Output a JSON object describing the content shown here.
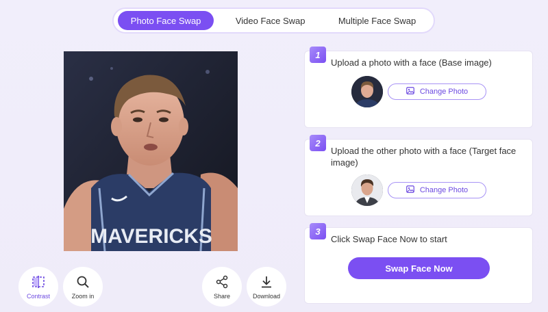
{
  "tabs": [
    {
      "label": "Photo Face Swap",
      "active": true
    },
    {
      "label": "Video Face Swap",
      "active": false
    },
    {
      "label": "Multiple Face Swap",
      "active": false
    }
  ],
  "preview": {
    "jersey_text": "MAVERICKS"
  },
  "tools": {
    "contrast": {
      "label": "Contrast",
      "icon": "compare-icon"
    },
    "zoom": {
      "label": "Zoom in",
      "icon": "zoom-icon"
    },
    "share": {
      "label": "Share",
      "icon": "share-icon"
    },
    "download": {
      "label": "Download",
      "icon": "download-icon"
    }
  },
  "steps": [
    {
      "number": "1",
      "title": "Upload a photo with a face (Base image)",
      "button": "Change Photo"
    },
    {
      "number": "2",
      "title": "Upload the other photo with a face (Target face image)",
      "button": "Change Photo"
    },
    {
      "number": "3",
      "title": "Click Swap Face Now to start",
      "button": "Swap Face Now"
    }
  ],
  "colors": {
    "accent": "#7b4ff2",
    "background": "#f1eefb"
  }
}
